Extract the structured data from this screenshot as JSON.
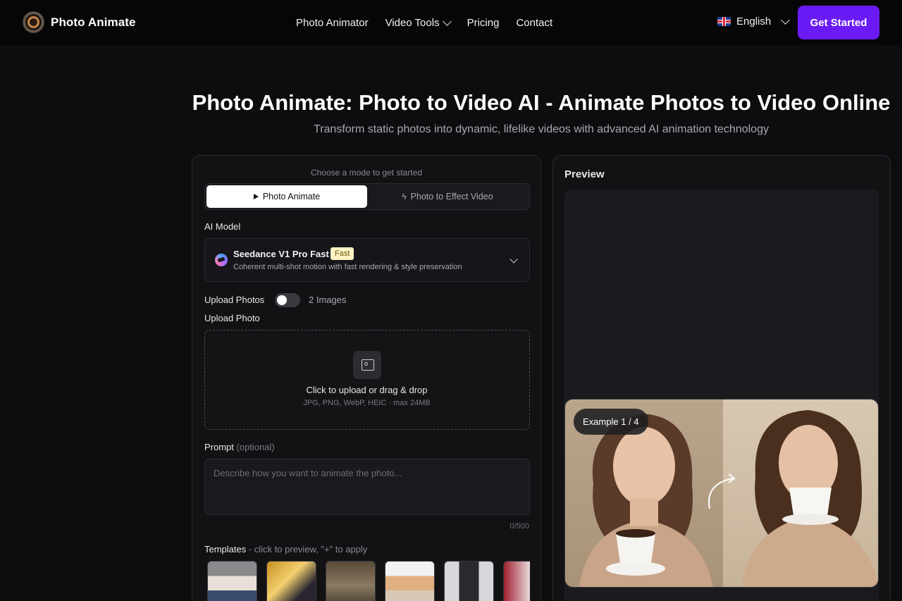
{
  "nav": {
    "brand": "Photo Animate",
    "links": [
      "Photo Animator",
      "Video Tools",
      "Pricing",
      "Contact"
    ],
    "language": "English",
    "cta": "Get Started"
  },
  "hero": {
    "title": "Photo Animate: Photo to Video AI - Animate Photos to Video Online",
    "subtitle": "Transform static photos into dynamic, lifelike videos with advanced AI animation technology"
  },
  "form": {
    "mode_hint": "Choose a mode to get started",
    "modes": [
      "Photo Animate",
      "Photo to Effect Video"
    ],
    "model_label": "AI Model",
    "model_name": "Seedance V1 Pro Fast",
    "model_badge": "Fast",
    "model_desc": "Coherent multi-shot motion with fast rendering & style preservation",
    "upload_photos_label": "Upload Photos",
    "toggle_text": "2 Images",
    "upload_photo_label": "Upload Photo",
    "upload_text": "Click to upload or drag & drop",
    "upload_formats": "JPG, PNG, WebP, HEIC · max 24MB",
    "prompt_label": "Prompt",
    "prompt_optional": "(optional)",
    "prompt_placeholder": "Describe how you want to animate the photo...",
    "counter": "0/500",
    "templates_label": "Templates",
    "templates_hint": " - click to preview, \"+\" to apply"
  },
  "preview": {
    "title": "Preview",
    "example_badge": "Example 1 / 4"
  },
  "colors": {
    "accent": "#6a1bf5",
    "background": "#0d0d10"
  }
}
